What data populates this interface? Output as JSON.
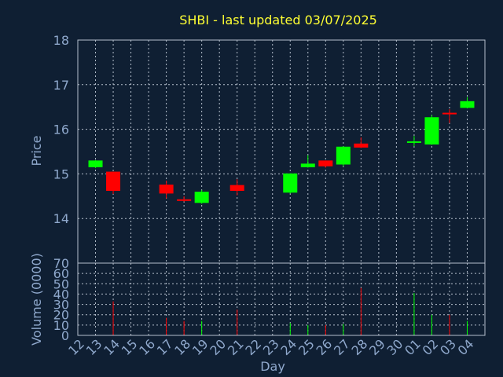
{
  "chart_data": [
    {
      "type": "candlestick",
      "title": "SHBI - last updated 03/07/2025",
      "ylabel": "Price",
      "ylim": [
        13.0,
        18.0
      ],
      "yticks": [
        14,
        15,
        16,
        17,
        18
      ],
      "x": [
        "12",
        "13",
        "14",
        "15",
        "16",
        "17",
        "18",
        "19",
        "20",
        "21",
        "22",
        "23",
        "24",
        "25",
        "26",
        "27",
        "28",
        "29",
        "30",
        "01",
        "02",
        "03",
        "04"
      ],
      "candles": [
        {
          "x": "12",
          "open": 15.15,
          "high": 15.31,
          "low": 15.13,
          "close": 15.3
        },
        {
          "x": "13",
          "open": 15.05,
          "high": 15.05,
          "low": 14.55,
          "close": 14.62
        },
        {
          "x": "16",
          "open": 14.76,
          "high": 14.85,
          "low": 14.45,
          "close": 14.56
        },
        {
          "x": "17",
          "open": 14.43,
          "high": 14.5,
          "low": 14.38,
          "close": 14.4
        },
        {
          "x": "18",
          "open": 14.35,
          "high": 14.64,
          "low": 14.33,
          "close": 14.6
        },
        {
          "x": "20",
          "open": 14.75,
          "high": 14.88,
          "low": 14.52,
          "close": 14.62
        },
        {
          "x": "23",
          "open": 14.58,
          "high": 15.01,
          "low": 14.56,
          "close": 15.01
        },
        {
          "x": "24",
          "open": 15.15,
          "high": 15.42,
          "low": 15.14,
          "close": 15.23
        },
        {
          "x": "25",
          "open": 15.3,
          "high": 15.3,
          "low": 15.14,
          "close": 15.17
        },
        {
          "x": "26",
          "open": 15.21,
          "high": 15.62,
          "low": 15.17,
          "close": 15.61
        },
        {
          "x": "27",
          "open": 15.68,
          "high": 15.82,
          "low": 15.58,
          "close": 15.59
        },
        {
          "x": "30",
          "open": 15.7,
          "high": 15.85,
          "low": 15.62,
          "close": 15.73
        },
        {
          "x": "01",
          "open": 15.66,
          "high": 16.32,
          "low": 15.65,
          "close": 16.27
        },
        {
          "x": "02",
          "open": 16.37,
          "high": 16.45,
          "low": 16.14,
          "close": 16.34
        },
        {
          "x": "03",
          "open": 16.48,
          "high": 16.72,
          "low": 16.47,
          "close": 16.63
        }
      ],
      "up_color": "#00ff00",
      "down_color": "#ff0000",
      "grid": true
    },
    {
      "type": "bar",
      "xlabel": "Day",
      "ylabel": "Volume (0000)",
      "ylim": [
        0,
        70
      ],
      "yticks": [
        0,
        10,
        20,
        30,
        40,
        50,
        60,
        70
      ],
      "x": [
        "12",
        "13",
        "14",
        "15",
        "16",
        "17",
        "18",
        "19",
        "20",
        "21",
        "22",
        "23",
        "24",
        "25",
        "26",
        "27",
        "28",
        "29",
        "30",
        "01",
        "02",
        "03",
        "04"
      ],
      "values": [
        {
          "x": "13",
          "value": 33,
          "direction": "down"
        },
        {
          "x": "16",
          "value": 17,
          "direction": "down"
        },
        {
          "x": "17",
          "value": 14,
          "direction": "down"
        },
        {
          "x": "18",
          "value": 14,
          "direction": "up"
        },
        {
          "x": "20",
          "value": 25,
          "direction": "down"
        },
        {
          "x": "23",
          "value": 12,
          "direction": "up"
        },
        {
          "x": "24",
          "value": 10,
          "direction": "up"
        },
        {
          "x": "25",
          "value": 10,
          "direction": "down"
        },
        {
          "x": "26",
          "value": 11,
          "direction": "up"
        },
        {
          "x": "27",
          "value": 46,
          "direction": "down"
        },
        {
          "x": "30",
          "value": 41,
          "direction": "up"
        },
        {
          "x": "01",
          "value": 20,
          "direction": "up"
        },
        {
          "x": "02",
          "value": 20,
          "direction": "down"
        },
        {
          "x": "03",
          "value": 14,
          "direction": "up"
        }
      ],
      "up_color": "#00ff00",
      "down_color": "#ff0000",
      "grid": true
    }
  ]
}
